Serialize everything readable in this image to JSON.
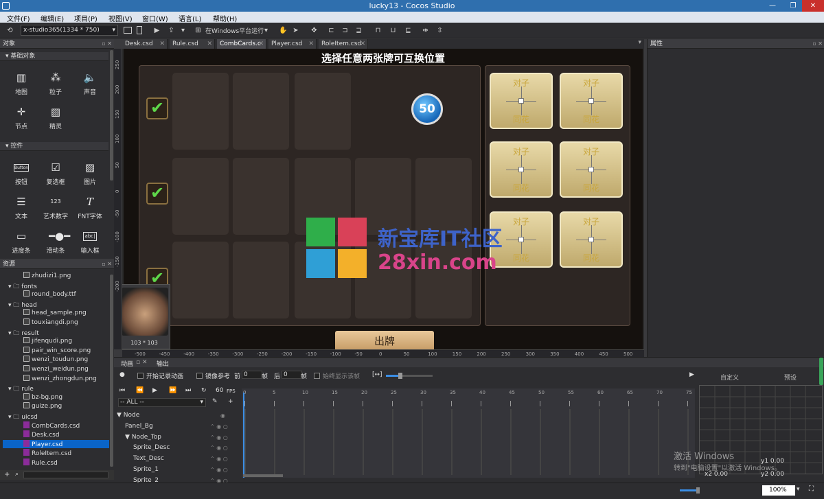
{
  "window": {
    "title": "lucky13 - Cocos Studio",
    "min": "—",
    "max": "❐",
    "close": "✕"
  },
  "menu": [
    "文件(F)",
    "编辑(E)",
    "项目(P)",
    "视图(V)",
    "窗口(W)",
    "语言(L)",
    "帮助(H)"
  ],
  "toolbar": {
    "resolution": "x-studio365(1334 * 750)",
    "run_target": "在Windows平台运行"
  },
  "objects_panel": {
    "title": "对象",
    "basic_section": "基础对象",
    "basic": [
      {
        "label": "地图",
        "icon": "map-icon"
      },
      {
        "label": "粒子",
        "icon": "particle-icon"
      },
      {
        "label": "声音",
        "icon": "sound-icon"
      },
      {
        "label": "节点",
        "icon": "node-icon"
      },
      {
        "label": "精灵",
        "icon": "sprite-icon"
      }
    ],
    "controls_section": "控件",
    "controls": [
      {
        "label": "按钮",
        "icon": "button-icon"
      },
      {
        "label": "复选框",
        "icon": "checkbox-icon"
      },
      {
        "label": "图片",
        "icon": "image-icon"
      },
      {
        "label": "文本",
        "icon": "text-icon"
      },
      {
        "label": "艺术数字",
        "icon": "art-number-icon"
      },
      {
        "label": "FNT字体",
        "icon": "fnt-font-icon"
      },
      {
        "label": "进度条",
        "icon": "progress-bar-icon"
      },
      {
        "label": "滑动条",
        "icon": "slider-icon"
      },
      {
        "label": "输入框",
        "icon": "input-box-icon"
      }
    ],
    "button_glyph": "Button",
    "artnum_glyph": "123",
    "input_glyph": "abc|"
  },
  "resources_panel": {
    "title": "资源",
    "items": [
      {
        "label": "zhudizi1.png",
        "type": "file",
        "depth": 2
      },
      {
        "label": "fonts",
        "type": "folder",
        "depth": 1
      },
      {
        "label": "round_body.ttf",
        "type": "file",
        "depth": 2
      },
      {
        "label": "head",
        "type": "folder",
        "depth": 1
      },
      {
        "label": "head_sample.png",
        "type": "file",
        "depth": 2
      },
      {
        "label": "touxiangdi.png",
        "type": "file",
        "depth": 2
      },
      {
        "label": "result",
        "type": "folder",
        "depth": 1
      },
      {
        "label": "jifenqudi.png",
        "type": "file",
        "depth": 2
      },
      {
        "label": "pair_win_score.png",
        "type": "file",
        "depth": 2
      },
      {
        "label": "wenzi_toudun.png",
        "type": "file",
        "depth": 2
      },
      {
        "label": "wenzi_weidun.png",
        "type": "file",
        "depth": 2
      },
      {
        "label": "wenzi_zhongdun.png",
        "type": "file",
        "depth": 2
      },
      {
        "label": "rule",
        "type": "folder",
        "depth": 1
      },
      {
        "label": "bz-bg.png",
        "type": "file",
        "depth": 2
      },
      {
        "label": "guize.png",
        "type": "file",
        "depth": 2
      },
      {
        "label": "uicsd",
        "type": "folder",
        "depth": 1
      },
      {
        "label": "CombCards.csd",
        "type": "csd",
        "depth": 2
      },
      {
        "label": "Desk.csd",
        "type": "csd",
        "depth": 2
      },
      {
        "label": "Player.csd",
        "type": "csd",
        "depth": 2,
        "selected": true
      },
      {
        "label": "RoleItem.csd",
        "type": "csd",
        "depth": 2
      },
      {
        "label": "Rule.csd",
        "type": "csd",
        "depth": 2
      }
    ]
  },
  "tabs": [
    "Desk.csd",
    "Rule.csd",
    "CombCards.c",
    "Player.csd",
    "RoleItem.csd"
  ],
  "active_tab": 2,
  "canvas": {
    "title": "选择任意两张牌可互换位置",
    "timer": "50",
    "avatar_size": "103 * 103",
    "bottom_button": "出牌",
    "card_top": "对子",
    "card_bottom": "同花",
    "ruler_h": [
      "-500",
      "-450",
      "-400",
      "-350",
      "-300",
      "-250",
      "-200",
      "-150",
      "-100",
      "-50",
      "0",
      "50",
      "100",
      "150",
      "200",
      "250",
      "300",
      "350",
      "400",
      "450",
      "500"
    ],
    "ruler_v": [
      "250",
      "200",
      "150",
      "100",
      "50",
      "0",
      "-50",
      "-100",
      "-150",
      "-200"
    ]
  },
  "watermark": {
    "line1": "新宝库IT社区",
    "line2": "28xin.com"
  },
  "properties_panel": {
    "title": "属性"
  },
  "bottom_panel": {
    "tabs": [
      "动画",
      "输出"
    ],
    "record": "开始记录动画",
    "mirror": "镜像参考",
    "front": "前",
    "front_val": "0",
    "frame": "帧",
    "back": "后",
    "back_val": "0",
    "frame2": "帧",
    "always_show": "始终显示该帧",
    "fps": "60",
    "fps_unit": "FPS",
    "filter": "-- ALL --",
    "custom": "自定义",
    "preset": "预设",
    "timeline_marks": [
      "0",
      "5",
      "10",
      "15",
      "20",
      "25",
      "30",
      "35",
      "40",
      "45",
      "50",
      "55",
      "60",
      "65",
      "70",
      "75"
    ],
    "nodes": [
      {
        "label": "Node",
        "depth": 0,
        "expander": "▼"
      },
      {
        "label": "Panel_Bg",
        "depth": 1,
        "expander": ""
      },
      {
        "label": "Node_Top",
        "depth": 1,
        "expander": "▼"
      },
      {
        "label": "Sprite_Desc",
        "depth": 2,
        "expander": ""
      },
      {
        "label": "Text_Desc",
        "depth": 2,
        "expander": ""
      },
      {
        "label": "Sprite_1",
        "depth": 2,
        "expander": ""
      },
      {
        "label": "Sprite_2",
        "depth": 2,
        "expander": ""
      }
    ],
    "y1": "y1  0.00",
    "x2": "x2  0.00",
    "y2": "y2  0.00"
  },
  "activation": {
    "line1": "激活 Windows",
    "line2": "转到\"电脑设置\"以激活 Windows。"
  },
  "status": {
    "zoom": "100%"
  }
}
